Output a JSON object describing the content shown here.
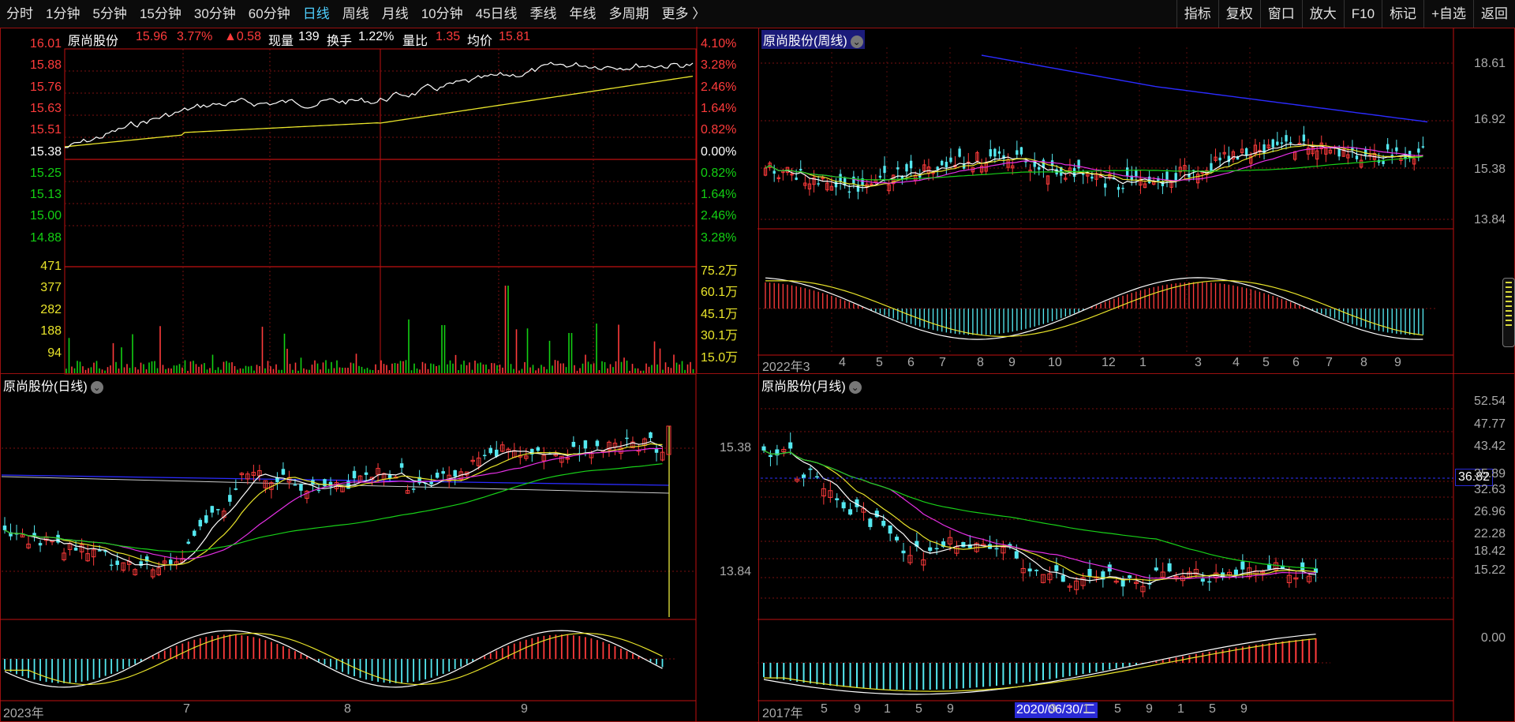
{
  "toolbar": {
    "tabs": [
      "分时",
      "1分钟",
      "5分钟",
      "15分钟",
      "30分钟",
      "60分钟",
      "日线",
      "周线",
      "月线",
      "10分钟",
      "45日线",
      "季线",
      "年线",
      "多周期",
      "更多 〉"
    ],
    "active_tab": "日线",
    "right_buttons": [
      "指标",
      "复权",
      "窗口",
      "放大",
      "F10",
      "标记",
      "+自选",
      "返回"
    ]
  },
  "intraday": {
    "name": "原尚股份",
    "price": "15.96",
    "pct": "3.77%",
    "change": "▲0.58",
    "volume_label": "现量",
    "volume_value": "139",
    "turnover_label": "换手",
    "turnover_value": "1.22%",
    "vol_ratio_label": "量比",
    "vol_ratio_value": "1.35",
    "avg_label": "均价",
    "avg_value": "15.81",
    "price_ticks": [
      "16.01",
      "15.88",
      "15.76",
      "15.63",
      "15.51",
      "15.38",
      "15.25",
      "15.13",
      "15.00",
      "14.88"
    ],
    "pct_ticks": [
      "4.10%",
      "3.28%",
      "2.46%",
      "1.64%",
      "0.82%",
      "0.00%",
      "0.82%",
      "1.64%",
      "2.46%",
      "3.28%"
    ],
    "vol_ticks_left": [
      "471",
      "377",
      "282",
      "188",
      "94"
    ],
    "vol_ticks_right": [
      "75.2万",
      "60.1万",
      "45.1万",
      "30.1万",
      "15.0万"
    ]
  },
  "weekly": {
    "title": "原尚股份(周线)",
    "price_ticks": [
      "18.61",
      "16.92",
      "15.38",
      "13.84"
    ],
    "x_labels": [
      "2022年3",
      "4",
      "5",
      "6",
      "7",
      "8",
      "9",
      "10",
      "12",
      "1",
      "3",
      "4",
      "5",
      "6",
      "7",
      "8",
      "9"
    ]
  },
  "daily": {
    "title": "原尚股份(日线)",
    "price_ticks": [
      "15.38",
      "13.84"
    ],
    "x_labels": [
      "2023年",
      "7",
      "8",
      "9"
    ]
  },
  "monthly": {
    "title": "原尚股份(月线)",
    "price_ticks": [
      "52.54",
      "47.77",
      "43.42",
      "35.89",
      "32.63",
      "26.96",
      "22.28",
      "18.42",
      "15.22"
    ],
    "macd_tick": "0.00",
    "cursor_price": "36.82",
    "cursor_date": "2020/06/30/二",
    "x_labels": [
      "2017年",
      "5",
      "9",
      "1",
      "5",
      "9",
      "1",
      "5",
      "9",
      "1",
      "5",
      "9",
      "1",
      "5",
      "9"
    ]
  },
  "colors": {
    "up": "#ff3b3b",
    "down": "#54e8f0",
    "ma5": "#ffffff",
    "ma10": "#e9e42a",
    "ma20": "#e630e6",
    "ma60": "#18d018",
    "ma120": "#2b2bff",
    "border": "#9a1010"
  }
}
